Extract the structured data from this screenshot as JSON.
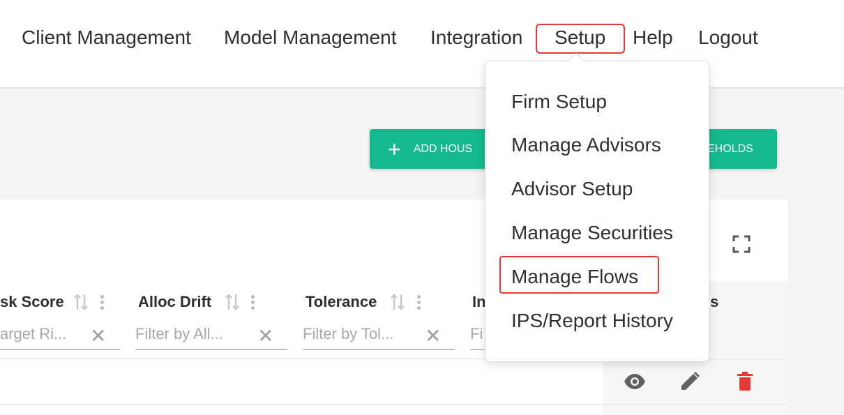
{
  "nav": {
    "items": [
      "Client Management",
      "Model Management",
      "Integration",
      "Setup",
      "Help",
      "Logout"
    ]
  },
  "toolbar": {
    "add_label": "ADD HOUS",
    "right_label": "EHOLDS",
    "plus_glyph": "+"
  },
  "table": {
    "columns": [
      {
        "label": "sk Score",
        "filter_placeholder": "arget Ri..."
      },
      {
        "label": "Alloc Drift",
        "filter_placeholder": "Filter by All..."
      },
      {
        "label": "Tolerance",
        "filter_placeholder": "Filter by Tol..."
      },
      {
        "label": "In",
        "filter_placeholder": "Fi"
      }
    ],
    "partial_right_header": "s",
    "clear_glyph": "✕"
  },
  "setup_menu": {
    "items": [
      "Firm Setup",
      "Manage Advisors",
      "Advisor Setup",
      "Manage Securities",
      "Manage Flows",
      "IPS/Report History"
    ],
    "highlighted": "Manage Flows"
  },
  "colors": {
    "accent": "#15b98f",
    "highlight": "#e53935",
    "delete": "#e53935"
  },
  "icons": [
    "expand-icon",
    "sort-icon",
    "more-vert-icon",
    "clear-icon",
    "view-icon",
    "edit-icon",
    "delete-icon"
  ]
}
